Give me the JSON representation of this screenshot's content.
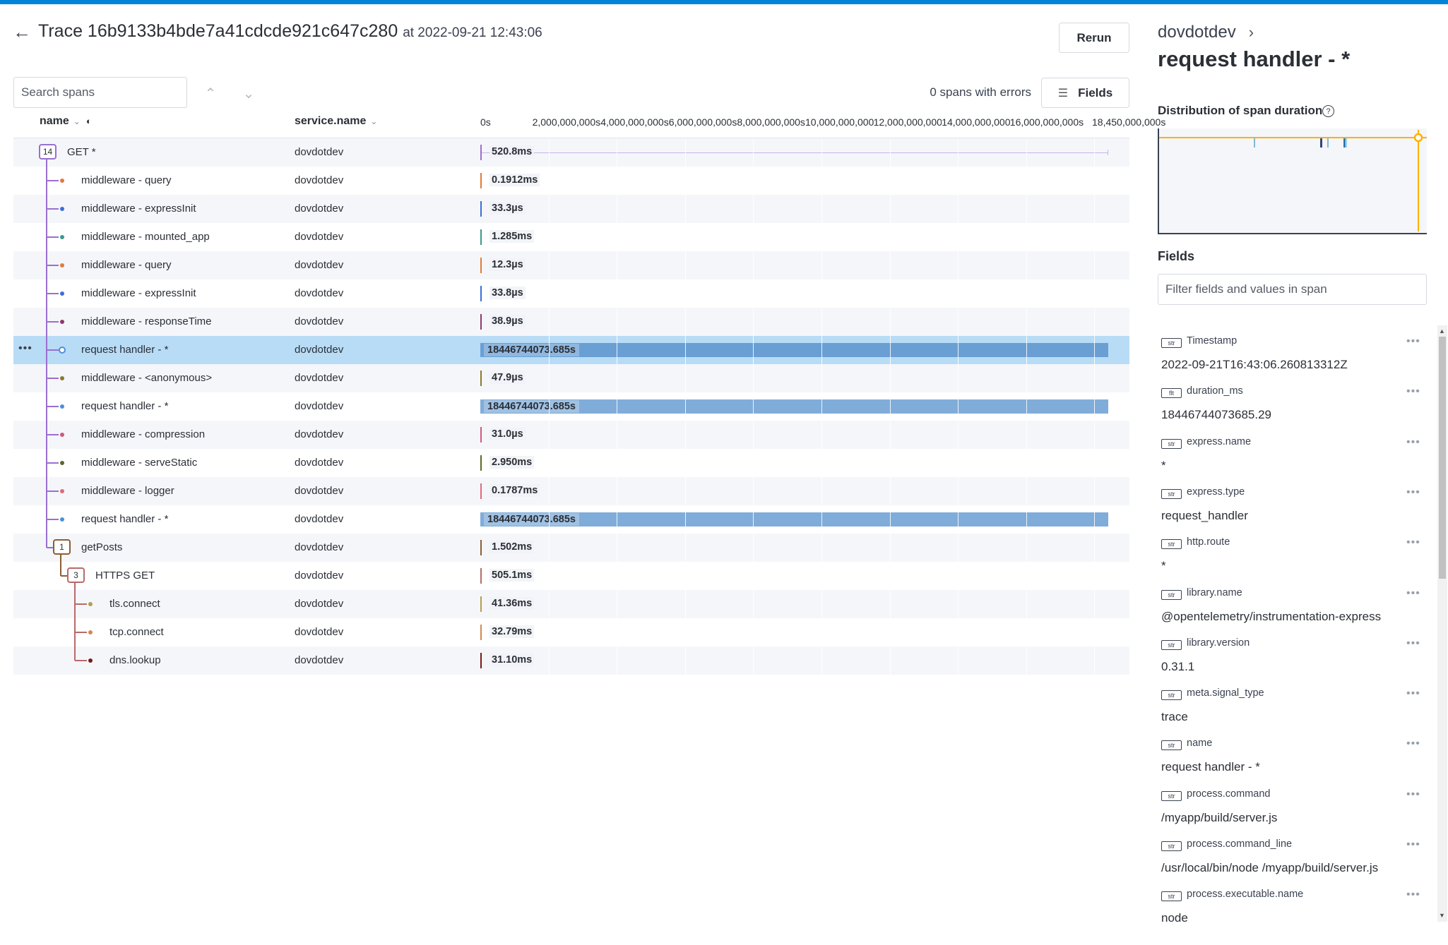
{
  "header": {
    "back_icon": "arrow-left-icon",
    "title": "Trace 16b9133b4bde7a41cdcde921c647c280",
    "at_label": "at 2022-09-21 12:43:06",
    "rerun_label": "Rerun"
  },
  "toolbar": {
    "search_placeholder": "Search spans",
    "errors_text": "0 spans with errors",
    "fields_label": "Fields"
  },
  "columns": {
    "name": "name",
    "service": "service.name"
  },
  "timeline": {
    "ticks": [
      "0s",
      "2,000,000,000s",
      "4,000,000,000s",
      "6,000,000,000s",
      "8,000,000,000s",
      "10,000,000,000s",
      "12,000,000,000s",
      "14,000,000,000s",
      "16,000,000,000s",
      "18,450,000,000s"
    ],
    "gridlines": 9
  },
  "spans": [
    {
      "name": "GET *",
      "service": "dovdotdev",
      "duration": "520.8ms",
      "depth": 0,
      "kind": "badge",
      "count": "14",
      "color": "#9b6fd0",
      "full": false,
      "root_line": true
    },
    {
      "name": "middleware - query",
      "service": "dovdotdev",
      "duration": "0.1912ms",
      "depth": 1,
      "kind": "leaf",
      "color": "#e07b39"
    },
    {
      "name": "middleware - expressInit",
      "service": "dovdotdev",
      "duration": "33.3µs",
      "depth": 1,
      "kind": "leaf",
      "color": "#3a6fd8"
    },
    {
      "name": "middleware - mounted_app",
      "service": "dovdotdev",
      "duration": "1.285ms",
      "depth": 1,
      "kind": "leaf",
      "color": "#3a9a8a"
    },
    {
      "name": "middleware - query",
      "service": "dovdotdev",
      "duration": "12.3µs",
      "depth": 1,
      "kind": "leaf",
      "color": "#e07b39"
    },
    {
      "name": "middleware - expressInit",
      "service": "dovdotdev",
      "duration": "33.8µs",
      "depth": 1,
      "kind": "leaf",
      "color": "#3a6fd8"
    },
    {
      "name": "middleware - responseTime",
      "service": "dovdotdev",
      "duration": "38.9µs",
      "depth": 1,
      "kind": "leaf",
      "color": "#8b3a6a"
    },
    {
      "name": "request handler - *",
      "service": "dovdotdev",
      "duration": "18446744073.685s",
      "depth": 1,
      "kind": "leaf",
      "color": "#4a90d9",
      "full": true,
      "selected": true
    },
    {
      "name": "middleware - <anonymous>",
      "service": "dovdotdev",
      "duration": "47.9µs",
      "depth": 1,
      "kind": "leaf",
      "color": "#8a7a2a"
    },
    {
      "name": "request handler - *",
      "service": "dovdotdev",
      "duration": "18446744073.685s",
      "depth": 1,
      "kind": "leaf",
      "color": "#4a90d9",
      "full": true
    },
    {
      "name": "middleware - compression",
      "service": "dovdotdev",
      "duration": "31.0µs",
      "depth": 1,
      "kind": "leaf",
      "color": "#d05a7a"
    },
    {
      "name": "middleware - serveStatic",
      "service": "dovdotdev",
      "duration": "2.950ms",
      "depth": 1,
      "kind": "leaf",
      "color": "#5a6a2a"
    },
    {
      "name": "middleware - logger",
      "service": "dovdotdev",
      "duration": "0.1787ms",
      "depth": 1,
      "kind": "leaf",
      "color": "#e06a7a"
    },
    {
      "name": "request handler - *",
      "service": "dovdotdev",
      "duration": "18446744073.685s",
      "depth": 1,
      "kind": "leaf",
      "color": "#4a90d9",
      "full": true
    },
    {
      "name": "getPosts",
      "service": "dovdotdev",
      "duration": "1.502ms",
      "depth": 1,
      "kind": "badge",
      "count": "1",
      "color": "#8b5e34"
    },
    {
      "name": "HTTPS GET",
      "service": "dovdotdev",
      "duration": "505.1ms",
      "depth": 2,
      "kind": "badge",
      "count": "3",
      "color": "#b86a6a"
    },
    {
      "name": "tls.connect",
      "service": "dovdotdev",
      "duration": "41.36ms",
      "depth": 3,
      "kind": "leaf",
      "color": "#b0a050"
    },
    {
      "name": "tcp.connect",
      "service": "dovdotdev",
      "duration": "32.79ms",
      "depth": 3,
      "kind": "leaf",
      "color": "#d08a50"
    },
    {
      "name": "dns.lookup",
      "service": "dovdotdev",
      "duration": "31.10ms",
      "depth": 3,
      "kind": "leaf",
      "color": "#7a1a1a"
    }
  ],
  "panel": {
    "service": "dovdotdev",
    "span_name": "request handler - *",
    "distribution_title": "Distribution of span duration",
    "highlight_color": "#ffb000",
    "fields_title": "Fields",
    "filter_placeholder": "Filter fields and values in span",
    "fields": [
      {
        "type": "str",
        "key": "Timestamp",
        "value": "2022-09-21T16:43:06.260813312Z"
      },
      {
        "type": "flt",
        "key": "duration_ms",
        "value": "18446744073685.29"
      },
      {
        "type": "str",
        "key": "express.name",
        "value": "*"
      },
      {
        "type": "str",
        "key": "express.type",
        "value": "request_handler"
      },
      {
        "type": "str",
        "key": "http.route",
        "value": "*"
      },
      {
        "type": "str",
        "key": "library.name",
        "value": "@opentelemetry/instrumentation-express"
      },
      {
        "type": "str",
        "key": "library.version",
        "value": "0.31.1"
      },
      {
        "type": "str",
        "key": "meta.signal_type",
        "value": "trace"
      },
      {
        "type": "str",
        "key": "name",
        "value": "request handler - *"
      },
      {
        "type": "str",
        "key": "process.command",
        "value": "/myapp/build/server.js"
      },
      {
        "type": "str",
        "key": "process.command_line",
        "value": "/usr/local/bin/node /myapp/build/server.js"
      },
      {
        "type": "str",
        "key": "process.executable.name",
        "value": "node"
      }
    ]
  }
}
